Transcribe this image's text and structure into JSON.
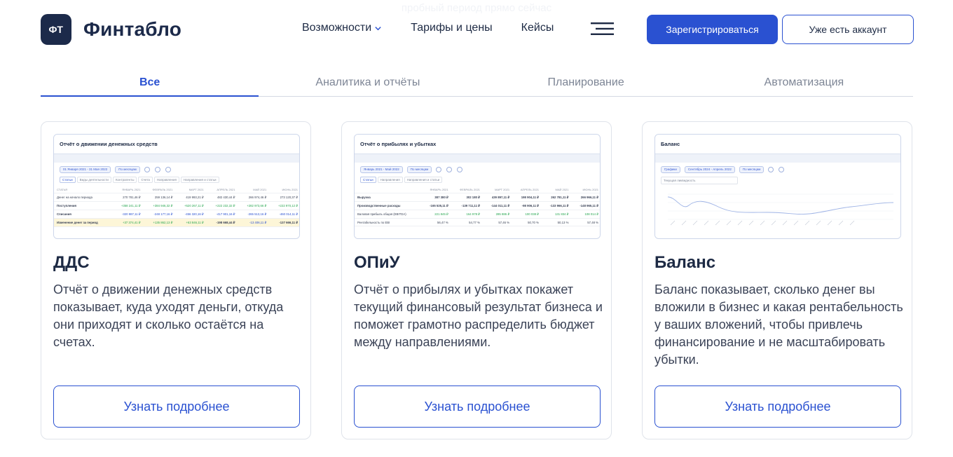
{
  "banner": {
    "ghost_text": "пробный период прямо сейчас"
  },
  "brand": {
    "mark": "ФТ",
    "name": "Финтабло"
  },
  "nav": {
    "items": [
      {
        "label": "Возможности"
      },
      {
        "label": "Тарифы и цены"
      },
      {
        "label": "Кейсы"
      }
    ],
    "register_label": "Зарегистрироваться",
    "login_label": "Уже есть аккаунт"
  },
  "tabs": [
    {
      "label": "Все",
      "active": true
    },
    {
      "label": "Аналитика и отчёты",
      "active": false
    },
    {
      "label": "Планирование",
      "active": false
    },
    {
      "label": "Автоматизация",
      "active": false
    }
  ],
  "cards": [
    {
      "title": "ДДС",
      "description": "Отчёт о движении денежных средств показывает, куда уходят деньги, откуда они приходят и сколько остаётся на счетах.",
      "button": "Узнать подробнее",
      "preview": {
        "title": "Отчёт о движении денежных средств",
        "period": "01 Января 2021 - 31 Мая 2022",
        "grouping": "По месяцам",
        "subtabs": [
          "Статьи",
          "Виды деятельности",
          "Контрагенты",
          "Счета",
          "Направления",
          "Направления и статьи"
        ],
        "columns": [
          "СТАТЬЯ",
          "ЯНВАРЬ 2021",
          "ФЕВРАЛЬ 2021",
          "МАРТ 2021",
          "АПРЕЛЬ 2021",
          "МАЙ 2021",
          "ИЮНЬ 2021"
        ],
        "rows": [
          {
            "label": "Денег на начало периода",
            "values": [
              "270 781,46 ₽",
              "259 136,14 ₽",
              "419 993,21 ₽",
              "482 430,44 ₽",
              "266 974,46 ₽",
              "273 120,37 ₽"
            ]
          },
          {
            "label": "Поступления",
            "values": [
              "+358 241,11 ₽",
              "+384 946,32 ₽",
              "+520 267,11 ₽",
              "+222 232,32 ₽",
              "+282 973,66 ₽",
              "+222 970,12 ₽"
            ]
          },
          {
            "label": "Списания",
            "values": [
              "-320 987,11 ₽",
              "-248 177,16 ₽",
              "-456 320,16 ₽",
              "-417 901,16 ₽",
              "-265 513,16 ₽",
              "-460 014,11 ₽"
            ]
          },
          {
            "label": "Изменение денег за период",
            "values": [
              "+37 374,41 ₽",
              "+135 862,13 ₽",
              "+63 846,11 ₽",
              "-198 668,44 ₽",
              "-13 406,11 ₽",
              "-137 666,11 ₽"
            ]
          }
        ]
      }
    },
    {
      "title": "ОПиУ",
      "description": "Отчёт о прибылях и убытках покажет текущий финансовый результат бизнеса и поможет грамотно распределить бюджет между направлениями.",
      "button": "Узнать подробнее",
      "preview": {
        "title": "Отчёт о прибылях и убытках",
        "period": "Январь 2021 - Май 2022",
        "grouping": "По месяцам",
        "subtabs": [
          "Статьи",
          "Направления",
          "Направления и статьи"
        ],
        "columns": [
          "",
          "ЯНВАРЬ 2021",
          "ФЕВРАЛЬ 2021",
          "МАРТ 2021",
          "АПРЕЛЬ 2021",
          "МАЙ 2021",
          "ИЮНЬ 2021"
        ],
        "rows": [
          {
            "label": "Выручка",
            "values": [
              "387 380 ₽",
              "302 180 ₽",
              "439 897,11 ₽",
              "198 904,11 ₽",
              "262 781,11 ₽",
              "266 966,11 ₽"
            ]
          },
          {
            "label": "Производственные расходы",
            "values": [
              "-165 535,11 ₽",
              "-139 711,11 ₽",
              "-144 011,11 ₽",
              "-98 906,11 ₽",
              "-133 966,11 ₽",
              "-148 965,11 ₽"
            ]
          },
          {
            "label": "Валовая прибыль общая (EBITDA)",
            "values": [
              "221 845 ₽",
              "164 978 ₽",
              "285 886 ₽",
              "100 038 ₽",
              "131 834 ₽",
              "108 014 ₽"
            ]
          },
          {
            "label": "Рентабельность по EBI",
            "values": [
              "56,47 %",
              "54,77 %",
              "57,46 %",
              "50,70 %",
              "50,13 %",
              "57,48 %"
            ]
          }
        ]
      }
    },
    {
      "title": "Баланс",
      "description": "Баланс показывает, сколько денег вы вложили в бизнес и какая рентабельность у ваших вложений, чтобы привлечь финансирование и не масштабировать убытки.",
      "button": "Узнать подробнее",
      "preview": {
        "title": "Баланс",
        "select_1": "Графики",
        "period": "Сентябрь 2024 - Апрель 2022",
        "grouping": "По месяцам",
        "metric": "Текущая ликвидность"
      }
    }
  ]
}
